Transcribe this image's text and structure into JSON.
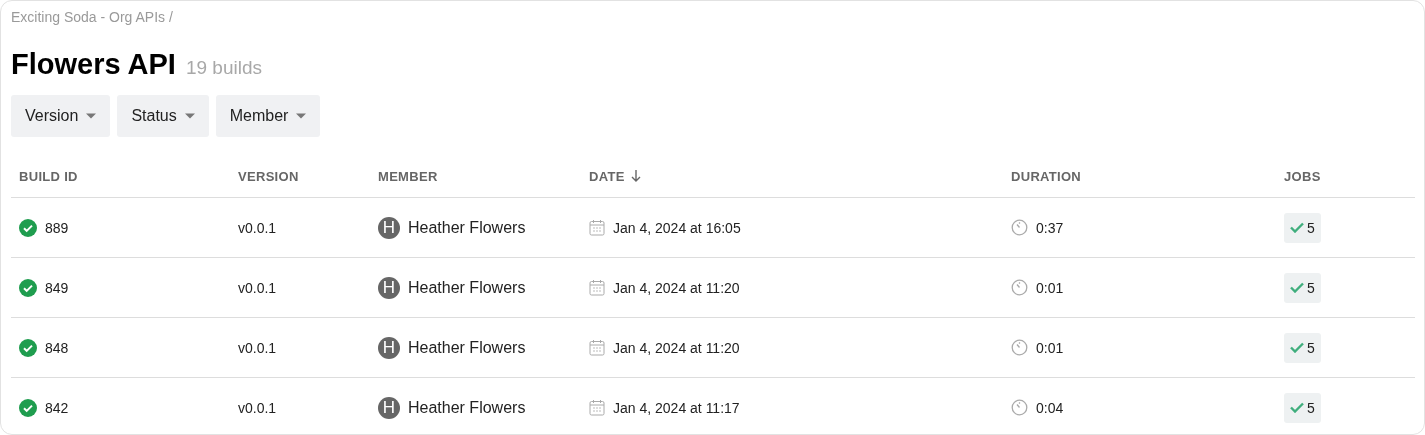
{
  "breadcrumb": "Exciting Soda - Org APIs /",
  "title": "Flowers API",
  "build_count": "19 builds",
  "filters": [
    "Version",
    "Status",
    "Member"
  ],
  "table": {
    "columns": [
      {
        "label": "BUILD ID",
        "sorted": false
      },
      {
        "label": "VERSION",
        "sorted": false
      },
      {
        "label": "MEMBER",
        "sorted": false
      },
      {
        "label": "DATE",
        "sorted": true
      },
      {
        "label": "DURATION",
        "sorted": false
      },
      {
        "label": "JOBS",
        "sorted": false
      }
    ],
    "rows": [
      {
        "passed": true,
        "build_id": "889",
        "version": "v0.0.1",
        "avatar": "H",
        "member": "Heather Flowers",
        "date": "Jan 4, 2024 at 16:05",
        "duration": "0:37",
        "jobs": "5"
      },
      {
        "passed": true,
        "build_id": "849",
        "version": "v0.0.1",
        "avatar": "H",
        "member": "Heather Flowers",
        "date": "Jan 4, 2024 at 11:20",
        "duration": "0:01",
        "jobs": "5"
      },
      {
        "passed": true,
        "build_id": "848",
        "version": "v0.0.1",
        "avatar": "H",
        "member": "Heather Flowers",
        "date": "Jan 4, 2024 at 11:20",
        "duration": "0:01",
        "jobs": "5"
      },
      {
        "passed": true,
        "build_id": "842",
        "version": "v0.0.1",
        "avatar": "H",
        "member": "Heather Flowers",
        "date": "Jan 4, 2024 at 11:17",
        "duration": "0:04",
        "jobs": "5"
      }
    ]
  }
}
